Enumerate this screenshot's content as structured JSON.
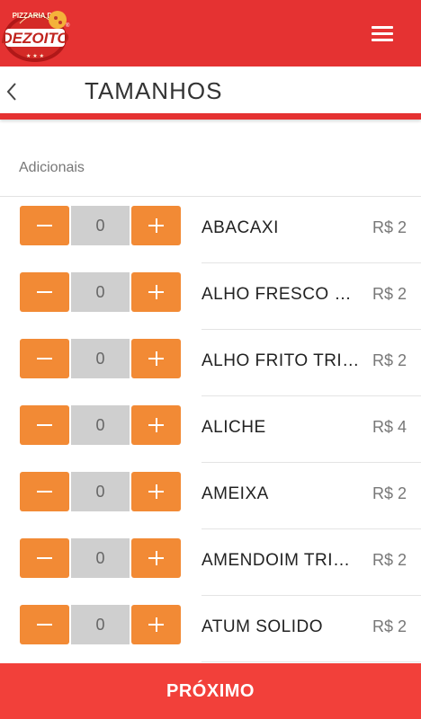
{
  "header": {
    "logo": {
      "icon": "pizzaria-do-dezoito-logo",
      "top_text": "PIZZARIA DO",
      "brand": "DEZOITO",
      "mark": "®"
    },
    "menu_icon": "hamburger-menu-icon"
  },
  "titlebar": {
    "back_icon": "chevron-left-icon",
    "title": "TAMANHOS"
  },
  "section": {
    "label": "Adicionais"
  },
  "items": [
    {
      "name": "ABACAXI",
      "quantity": "0",
      "price": "R$ 2"
    },
    {
      "name": "ALHO FRESCO FATIADO",
      "quantity": "0",
      "price": "R$ 2"
    },
    {
      "name": "ALHO FRITO TRITURADO",
      "quantity": "0",
      "price": "R$ 2"
    },
    {
      "name": "ALICHE",
      "quantity": "0",
      "price": "R$ 4"
    },
    {
      "name": "AMEIXA",
      "quantity": "0",
      "price": "R$ 2"
    },
    {
      "name": "AMENDOIM TRITURADO",
      "quantity": "0",
      "price": "R$ 2"
    },
    {
      "name": "ATUM SOLIDO",
      "quantity": "0",
      "price": "R$ 2"
    }
  ],
  "footer": {
    "next_label": "PRÓXIMO"
  },
  "colors": {
    "primary": "#e53232",
    "accent": "#f28a35",
    "button": "#f2403a",
    "qty_bg": "#cfcfcf"
  }
}
